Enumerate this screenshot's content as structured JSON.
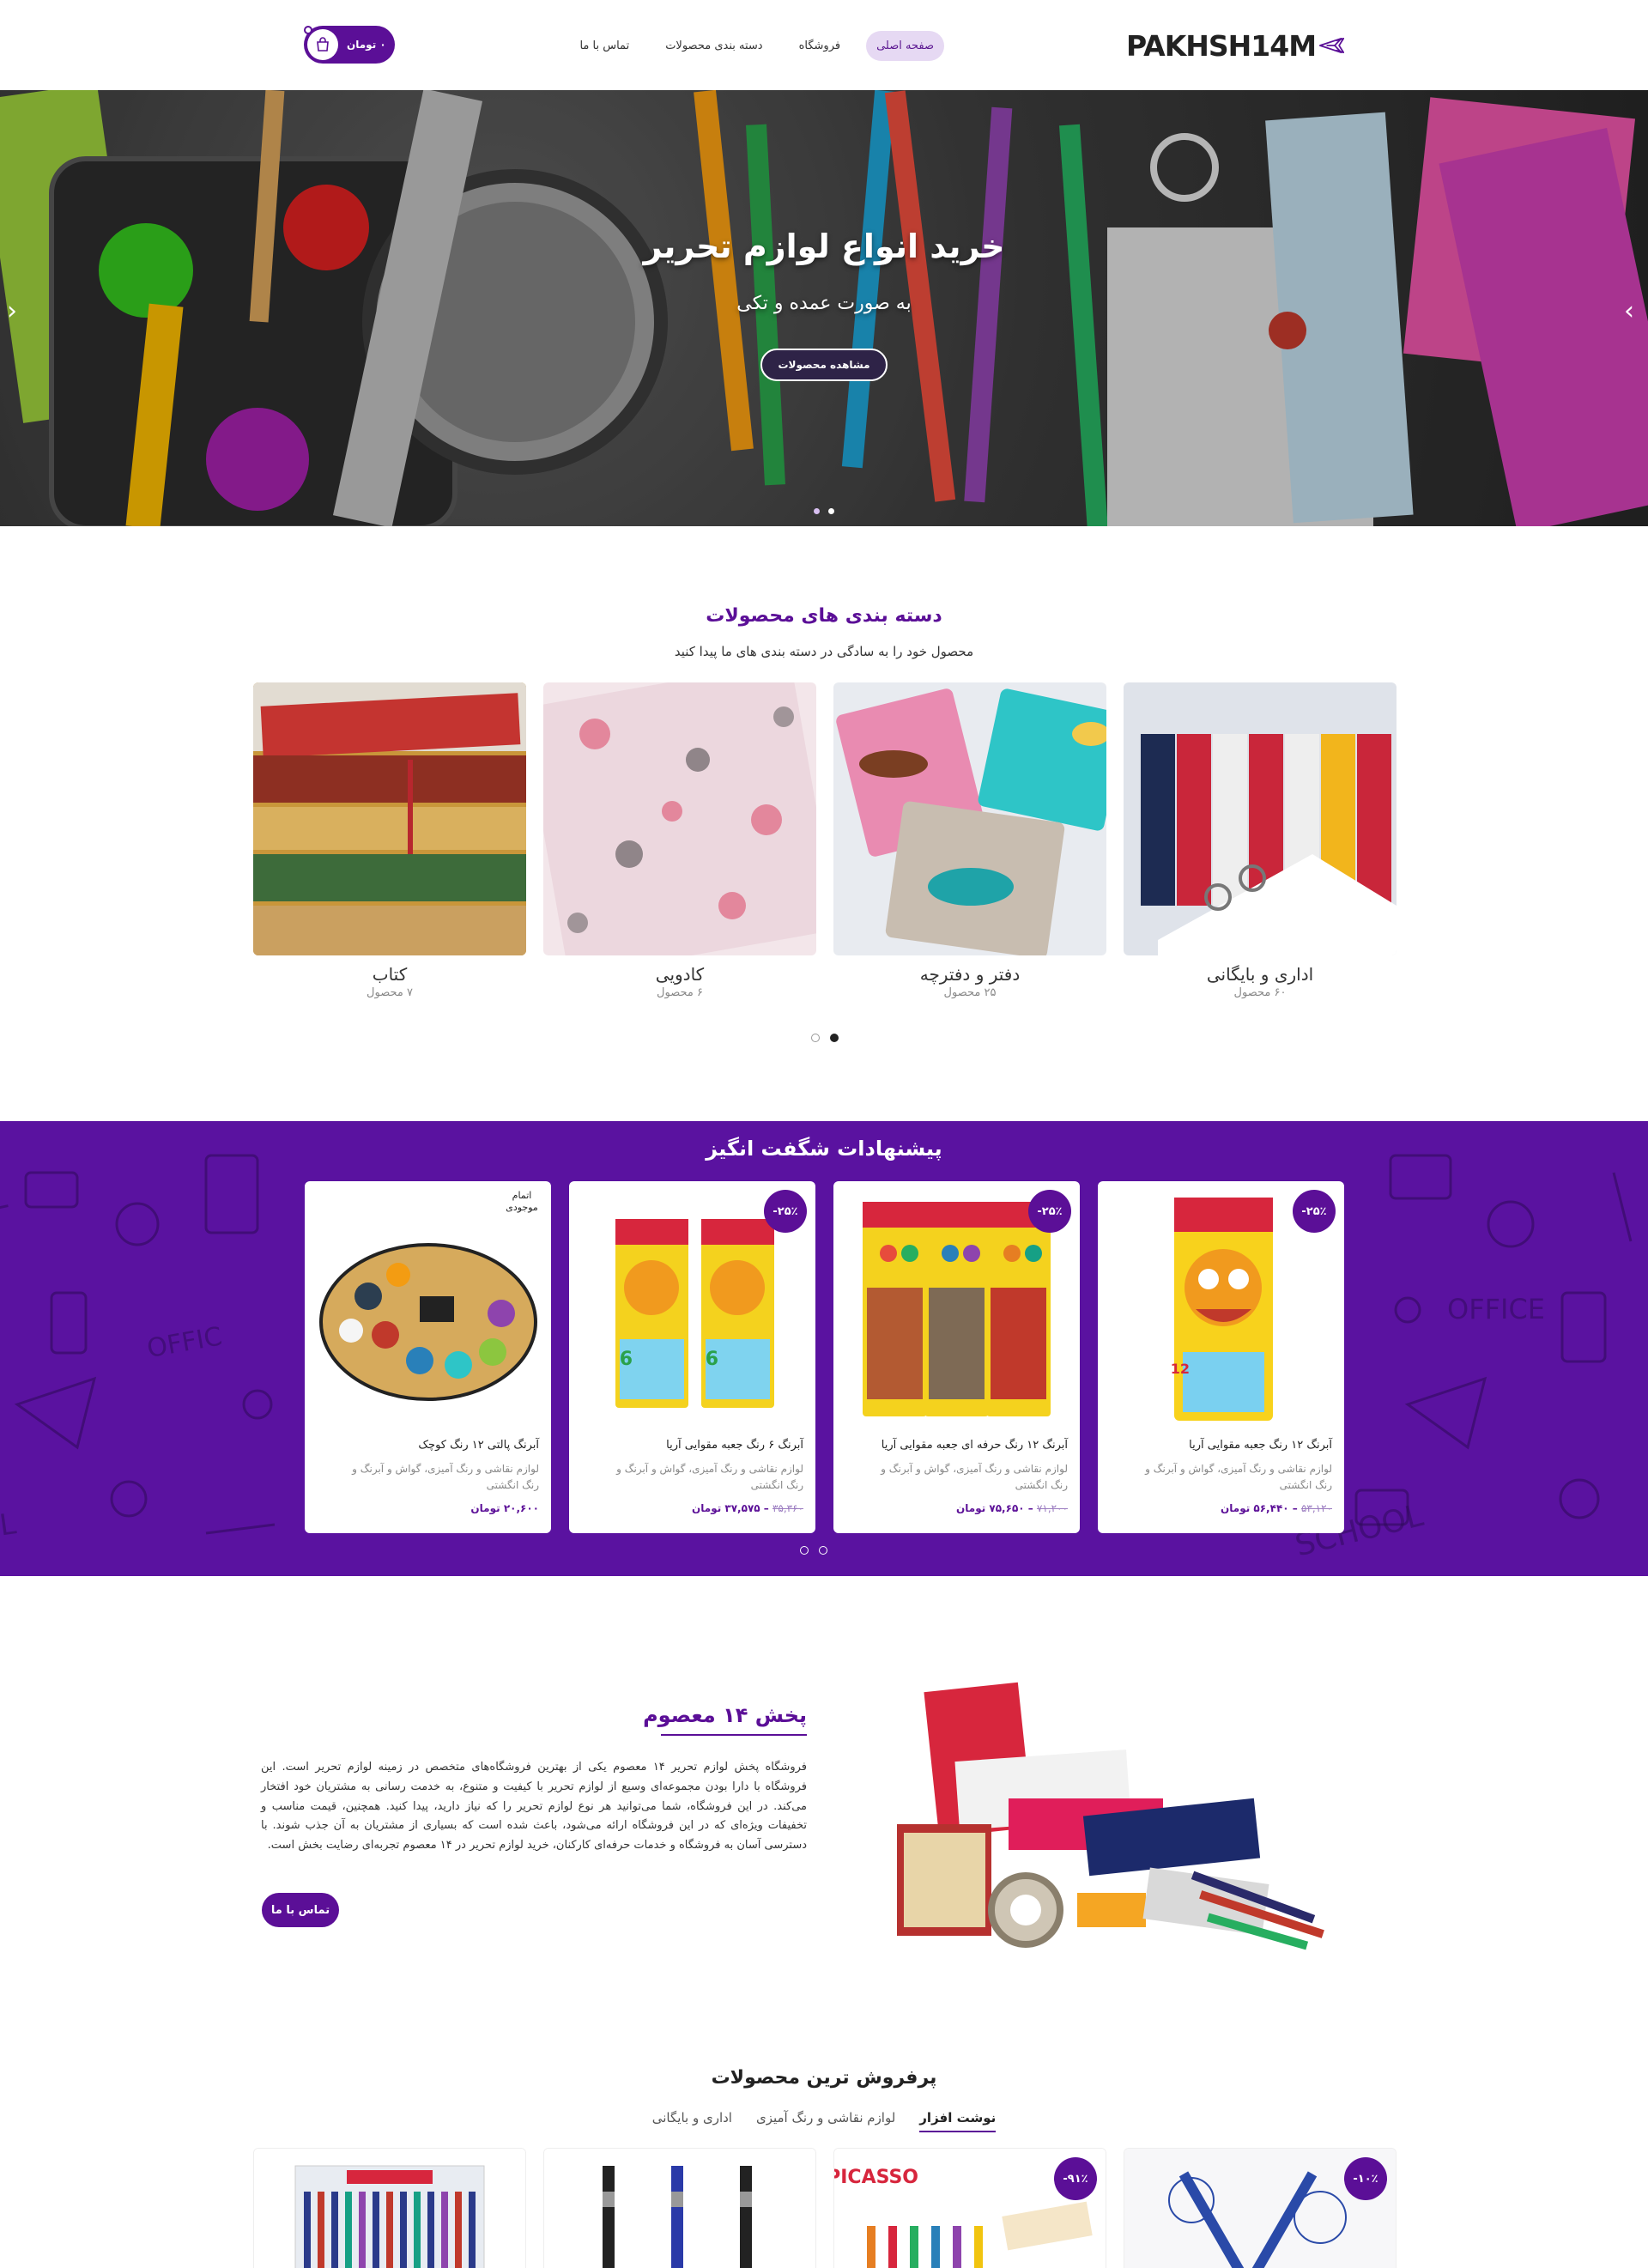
{
  "header": {
    "logo_text": "PAKHSH14M",
    "nav": [
      "صفحه اصلی",
      "فروشگاه",
      "دسته بندی محصولات",
      "تماس با ما"
    ],
    "cart_total": "۰ تومان"
  },
  "hero": {
    "title": "خرید انواع لوازم تحریر",
    "subtitle": "به صورت عمده و تکی",
    "button": "مشاهده محصولات"
  },
  "categories": {
    "title": "دسته بندی های محصولات",
    "subtitle": "محصول خود را به سادگی در دسته بندی های ما پیدا کنید",
    "items": [
      {
        "name": "اداری و بایگانی",
        "count": "۶۰ محصول",
        "icon": "binders-image"
      },
      {
        "name": "دفتر و دفترچه",
        "count": "۲۵ محصول",
        "icon": "notebooks-image"
      },
      {
        "name": "کادویی",
        "count": "۶ محصول",
        "icon": "gift-paper-image"
      },
      {
        "name": "کتاب",
        "count": "۷ محصول",
        "icon": "books-image"
      }
    ]
  },
  "offers": {
    "title": "پیشنهادات شگفت انگیز",
    "items": [
      {
        "badge": "۲۵٪-",
        "name": "آبرنگ ۱۲ رنگ جعبه مقوایی آریا",
        "category": "لوازم نقاشی و رنگ آمیزی، گواش و آبرنگ و رنگ انگشتی",
        "old_price": "۵۳,۱۲۰",
        "price": "۵۶,۴۴۰ تومان"
      },
      {
        "badge": "۲۵٪-",
        "name": "آبرنگ ۱۲ رنگ حرفه ای جعبه مقوایی آریا",
        "category": "لوازم نقاشی و رنگ آمیزی، گواش و آبرنگ و رنگ انگشتی",
        "old_price": "۷۱,۲۰۰",
        "price": "۷۵,۶۵۰ تومان"
      },
      {
        "badge": "۲۵٪-",
        "name": "آبرنگ ۶ رنگ جعبه مقوایی آریا",
        "category": "لوازم نقاشی و رنگ آمیزی، گواش و آبرنگ و رنگ انگشتی",
        "old_price": "۳۵,۳۶۰",
        "price": "۳۷,۵۷۵ تومان"
      },
      {
        "badge": "اتمام موجودی",
        "name": "آبرنگ پالتی ۱۲ رنگ کوچک",
        "category": "لوازم نقاشی و رنگ آمیزی، گواش و آبرنگ و رنگ انگشتی",
        "old_price": "",
        "price": "۲۰,۶۰۰ تومان"
      }
    ]
  },
  "about": {
    "title": "پخش ۱۴ معصوم",
    "text": "فروشگاه پخش لوازم تحریر ۱۴ معصوم یکی از بهترین فروشگاه‌های متخصص در زمینه لوازم تحریر است. این فروشگاه با دارا بودن مجموعه‌ای وسیع از لوازم تحریر با کیفیت و متنوع، به خدمت رسانی به مشتریان خود افتخار می‌کند. در این فروشگاه، شما می‌توانید هر نوع لوازم تحریر را که نیاز دارید، پیدا کنید. همچنین، قیمت مناسب و تخفیفات ویژه‌ای که در این فروشگاه ارائه می‌شود، باعث شده است که بسیاری از مشتریان به آن جذب شوند. با دسترسی آسان به فروشگاه و خدمات حرفه‌ای کارکنان، خرید لوازم تحریر در ۱۴ معصوم تجربه‌ای رضایت بخش است.",
    "button": "تماس با ما"
  },
  "best": {
    "title": "پرفروش ترین محصولات",
    "tabs": [
      "نوشت افزار",
      "لوازم نقاشی و رنگ آمیزی",
      "اداری و بایگانی"
    ],
    "badges": [
      "۱۰٪-",
      "۹۱٪-"
    ],
    "brand_text": "PICASSO"
  },
  "colors": {
    "primary": "#5b0f97",
    "accent": "#e6d9f3"
  }
}
